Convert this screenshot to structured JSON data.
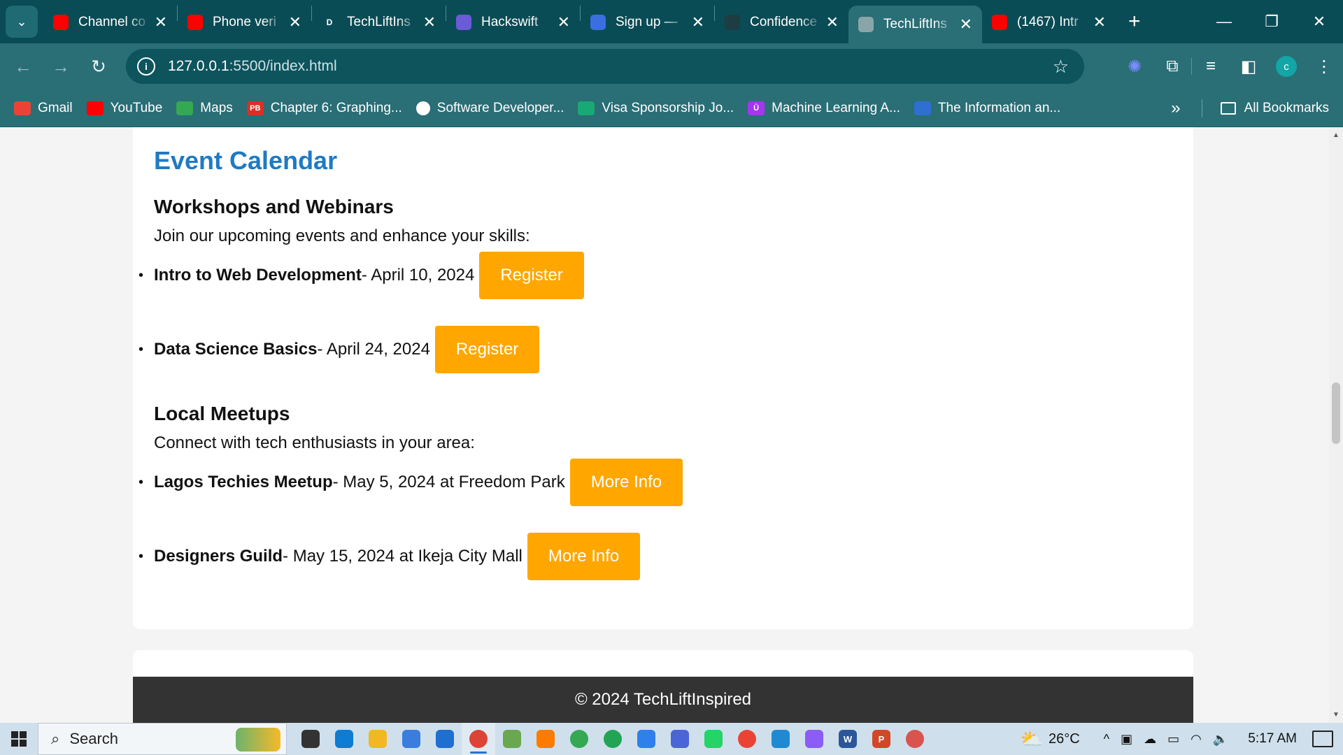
{
  "browser": {
    "tabs": [
      {
        "title": "Channel co",
        "favicon": "youtube-icon",
        "color": "#ff0000",
        "active": false
      },
      {
        "title": "Phone veri",
        "favicon": "youtube-icon",
        "color": "#ff0000",
        "active": false
      },
      {
        "title": "TechLiftIns",
        "favicon": "d-letter-icon",
        "glyph": "D",
        "color": "#0a4c55",
        "active": false
      },
      {
        "title": "Hackswift",
        "favicon": "list-icon",
        "color": "#6b5bd6",
        "active": false
      },
      {
        "title": "Sign up —",
        "favicon": "x-logo-icon",
        "color": "#3b6fe0",
        "active": false
      },
      {
        "title": "Confidence",
        "favicon": "github-icon",
        "color": "#1d3d42",
        "active": false
      },
      {
        "title": "TechLiftIns",
        "favicon": "globe-icon",
        "color": "#8aa5a8",
        "active": true
      },
      {
        "title": "(1467) Intr",
        "favicon": "youtube-icon",
        "color": "#ff0000",
        "active": false
      }
    ],
    "url_host": "127.0.0.1",
    "url_path": ":5500/index.html",
    "profile_initial": "c",
    "bookmarks": [
      {
        "label": "Gmail",
        "icon": "gmail-icon",
        "color": "#ea4335"
      },
      {
        "label": "YouTube",
        "icon": "youtube-icon",
        "color": "#ff0000"
      },
      {
        "label": "Maps",
        "icon": "maps-pin-icon",
        "color": "#34a853"
      },
      {
        "label": "Chapter 6: Graphing...",
        "icon": "pb-icon",
        "glyph": "PB",
        "color": "#d93025"
      },
      {
        "label": "Software Developer...",
        "icon": "globe-icon",
        "color": "#ffffff"
      },
      {
        "label": "Visa Sponsorship Jo...",
        "icon": "vs-icon",
        "color": "#19a974"
      },
      {
        "label": "Machine Learning A...",
        "icon": "udemy-icon",
        "glyph": "Ū",
        "color": "#a435f0"
      },
      {
        "label": "The Information an...",
        "icon": "earth-icon",
        "color": "#2e6fd1"
      }
    ],
    "all_bookmarks_label": "All Bookmarks"
  },
  "page": {
    "heading": "Event Calendar",
    "workshops": {
      "title": "Workshops and Webinars",
      "lead": "Join our upcoming events and enhance your skills:",
      "events": [
        {
          "name": "Intro to Web Development",
          "detail": " - April 10, 2024",
          "button": "Register"
        },
        {
          "name": "Data Science Basics",
          "detail": " - April 24, 2024",
          "button": "Register"
        }
      ]
    },
    "meetups": {
      "title": "Local Meetups",
      "lead": "Connect with tech enthusiasts in your area:",
      "events": [
        {
          "name": "Lagos Techies Meetup",
          "detail": " - May 5, 2024 at Freedom Park",
          "button": "More Info"
        },
        {
          "name": "Designers Guild",
          "detail": " - May 15, 2024 at Ikeja City Mall",
          "button": "More Info"
        }
      ]
    },
    "footer": "© 2024 TechLiftInspired",
    "accent_color": "#ffa600",
    "heading_color": "#1f7ac2"
  },
  "taskbar": {
    "search_placeholder": "Search",
    "apps": [
      {
        "icon": "task-view-icon",
        "color": "#333333"
      },
      {
        "icon": "edge-icon",
        "color": "#0c7cd5"
      },
      {
        "icon": "file-explorer-icon",
        "color": "#f3b723"
      },
      {
        "icon": "store-icon",
        "color": "#3b7ddd"
      },
      {
        "icon": "mail-icon",
        "color": "#1f6fd1"
      },
      {
        "icon": "chrome-icon",
        "color": "#db4437",
        "active": true
      },
      {
        "icon": "notepad-icon",
        "color": "#6aa84f"
      },
      {
        "icon": "firefox-icon",
        "color": "#ff7b00"
      },
      {
        "icon": "chrome-profile-icon",
        "color": "#34a853"
      },
      {
        "icon": "circle-app-icon",
        "color": "#22a455"
      },
      {
        "icon": "app-store-icon",
        "color": "#2f80ed"
      },
      {
        "icon": "shield-app-icon",
        "color": "#4a65d8"
      },
      {
        "icon": "whatsapp-icon",
        "color": "#25d366"
      },
      {
        "icon": "chrome-alt-icon",
        "color": "#ea4335"
      },
      {
        "icon": "vscode-icon",
        "color": "#1f8ad2"
      },
      {
        "icon": "copilot-icon",
        "color": "#8b5cf6"
      },
      {
        "icon": "word-icon",
        "color": "#2b579a",
        "glyph": "W"
      },
      {
        "icon": "powerpoint-icon",
        "color": "#d24726",
        "glyph": "P"
      },
      {
        "icon": "media-player-icon",
        "color": "#d9534f"
      }
    ],
    "temperature": "26°C",
    "time": "5:17 AM"
  }
}
